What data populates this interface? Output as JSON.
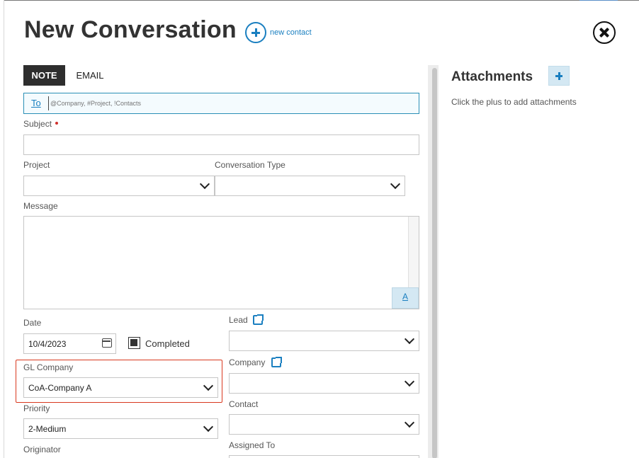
{
  "modal": {
    "title": "New Conversation",
    "new_contact_label": "new contact"
  },
  "tabs": [
    {
      "label": "NOTE",
      "active": true
    },
    {
      "label": "EMAIL",
      "active": false
    }
  ],
  "to_field": {
    "label": "To",
    "placeholder": "@Company, #Project, !Contacts",
    "value": ""
  },
  "subject": {
    "label": "Subject",
    "value": ""
  },
  "project": {
    "label": "Project",
    "value": ""
  },
  "conversation_type": {
    "label": "Conversation Type",
    "value": ""
  },
  "message": {
    "label": "Message",
    "value": "",
    "format_button": "A"
  },
  "date": {
    "label": "Date",
    "value": "10/4/2023"
  },
  "completed": {
    "label": "Completed",
    "checked": true
  },
  "gl_company": {
    "label": "GL Company",
    "value": "CoA-Company A"
  },
  "priority": {
    "label": "Priority",
    "value": "2-Medium"
  },
  "originator": {
    "label": "Originator"
  },
  "lead": {
    "label": "Lead",
    "value": ""
  },
  "company": {
    "label": "Company",
    "value": ""
  },
  "contact": {
    "label": "Contact",
    "value": ""
  },
  "assigned_to": {
    "label": "Assigned To"
  },
  "attachments": {
    "title": "Attachments",
    "hint": "Click the plus to add attachments"
  },
  "colors": {
    "accent": "#1a7fc0",
    "highlight": "#d9381e",
    "tab_active": "#2e2e2e"
  }
}
